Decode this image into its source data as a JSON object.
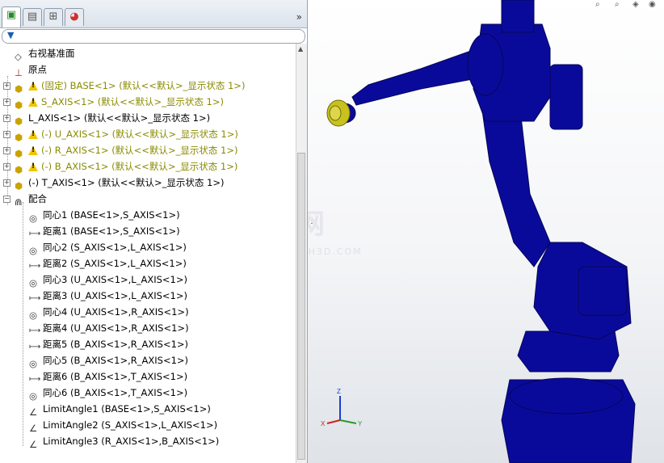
{
  "tabs": [
    {
      "name": "feature-manager-tab",
      "icon": "feature-tree-icon"
    },
    {
      "name": "property-manager-tab",
      "icon": "property-icon"
    },
    {
      "name": "configuration-manager-tab",
      "icon": "configuration-icon"
    },
    {
      "name": "display-manager-tab",
      "icon": "appearance-icon"
    }
  ],
  "expand_chevron": "»",
  "filter_icon": "▼",
  "tree": [
    {
      "label": "右视基准面",
      "kind": "plane",
      "yellow": false
    },
    {
      "label": "原点",
      "kind": "origin",
      "yellow": false
    },
    {
      "label": "(固定) BASE<1> (默认<<默认>_显示状态 1>)",
      "kind": "part-warn",
      "yellow": true
    },
    {
      "label": "S_AXIS<1> (默认<<默认>_显示状态 1>)",
      "kind": "part-warn",
      "yellow": true
    },
    {
      "label": "L_AXIS<1> (默认<<默认>_显示状态 1>)",
      "kind": "part",
      "yellow": false
    },
    {
      "label": "(-) U_AXIS<1> (默认<<默认>_显示状态 1>)",
      "kind": "part-warn",
      "yellow": true
    },
    {
      "label": "(-) R_AXIS<1> (默认<<默认>_显示状态 1>)",
      "kind": "part-warn",
      "yellow": true
    },
    {
      "label": "(-) B_AXIS<1> (默认<<默认>_显示状态 1>)",
      "kind": "part-warn",
      "yellow": true
    },
    {
      "label": "(-) T_AXIS<1> (默认<<默认>_显示状态 1>)",
      "kind": "part",
      "yellow": false
    },
    {
      "label": "配合",
      "kind": "mates",
      "yellow": false
    }
  ],
  "mates": [
    {
      "label": "同心1 (BASE<1>,S_AXIS<1>)",
      "kind": "concentric"
    },
    {
      "label": "距离1 (BASE<1>,S_AXIS<1>)",
      "kind": "distance"
    },
    {
      "label": "同心2 (S_AXIS<1>,L_AXIS<1>)",
      "kind": "concentric"
    },
    {
      "label": "距离2 (S_AXIS<1>,L_AXIS<1>)",
      "kind": "distance"
    },
    {
      "label": "同心3 (U_AXIS<1>,L_AXIS<1>)",
      "kind": "concentric"
    },
    {
      "label": "距离3 (U_AXIS<1>,L_AXIS<1>)",
      "kind": "distance"
    },
    {
      "label": "同心4 (U_AXIS<1>,R_AXIS<1>)",
      "kind": "concentric"
    },
    {
      "label": "距离4 (U_AXIS<1>,R_AXIS<1>)",
      "kind": "distance"
    },
    {
      "label": "距离5 (B_AXIS<1>,R_AXIS<1>)",
      "kind": "distance"
    },
    {
      "label": "同心5 (B_AXIS<1>,R_AXIS<1>)",
      "kind": "concentric"
    },
    {
      "label": "距离6 (B_AXIS<1>,T_AXIS<1>)",
      "kind": "distance"
    },
    {
      "label": "同心6 (B_AXIS<1>,T_AXIS<1>)",
      "kind": "concentric"
    },
    {
      "label": "LimitAngle1 (BASE<1>,S_AXIS<1>)",
      "kind": "angle"
    },
    {
      "label": "LimitAngle2 (S_AXIS<1>,L_AXIS<1>)",
      "kind": "angle"
    },
    {
      "label": "LimitAngle3 (R_AXIS<1>,B_AXIS<1>)",
      "kind": "angle"
    }
  ],
  "viewport": {
    "watermark": "临双网",
    "watermark_url": "WWW.YSH3D.COM",
    "triad": {
      "x": "X",
      "y": "Y",
      "z": "Z"
    },
    "model_color": "#0a0a9a",
    "highlight_color": "#c8c21e"
  },
  "colors": {
    "warning_text": "#8a8a00",
    "warning_icon": "#f2c400"
  }
}
